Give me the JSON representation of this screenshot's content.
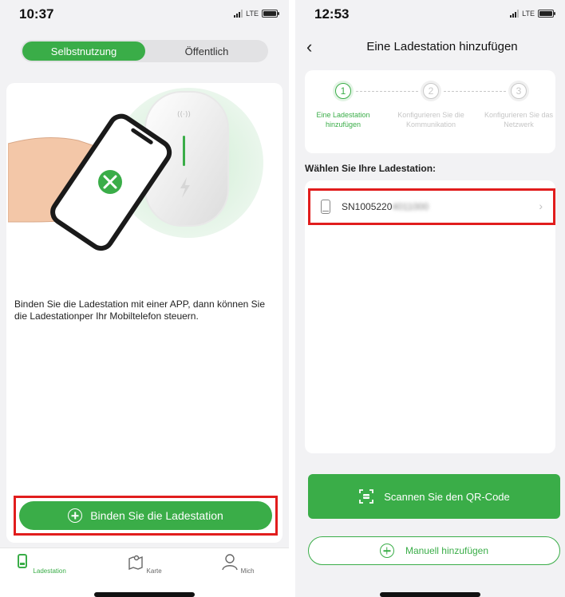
{
  "left": {
    "status_time": "10:37",
    "network": "LTE",
    "segment": {
      "active": "Selbstnutzung",
      "inactive": "Öffentlich"
    },
    "description": "Binden Sie die Ladestation mit einer APP, dann können Sie die Ladestationper Ihr Mobiltelefon steuern.",
    "bind_button": "Binden Sie die Ladestation",
    "tabs": [
      {
        "label": "Ladestation",
        "icon": "charger-icon",
        "active": true
      },
      {
        "label": "Karte",
        "icon": "map-icon",
        "active": false
      },
      {
        "label": "Mich",
        "icon": "user-icon",
        "active": false
      }
    ],
    "colors": {
      "accent": "#3aad48",
      "highlight": "#e11d1d",
      "error": "#3aad48"
    }
  },
  "right": {
    "status_time": "12:53",
    "network": "LTE",
    "title": "Eine Ladestation hinzufügen",
    "steps": [
      {
        "num": "1",
        "label": "Eine Ladestation hinzufügen",
        "active": true
      },
      {
        "num": "2",
        "label": "Konfigurieren Sie die Kommunikation",
        "active": false
      },
      {
        "num": "3",
        "label": "Konfigurieren Sie das Netzwerk",
        "active": false
      }
    ],
    "select_label": "Wählen Sie Ihre Ladestation:",
    "device": {
      "sn_visible": "SN1005220",
      "sn_obscured": "4011000"
    },
    "scan_button": "Scannen Sie den QR-Code",
    "manual_button": "Manuell hinzufügen"
  }
}
